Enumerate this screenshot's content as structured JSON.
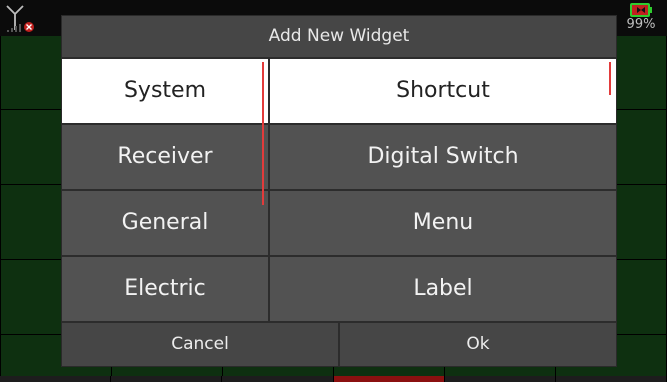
{
  "status": {
    "battery_percent": "99%"
  },
  "dialog": {
    "title": "Add New Widget",
    "categories": [
      "System",
      "Receiver",
      "General",
      "Electric"
    ],
    "widgets": [
      "Shortcut",
      "Digital Switch",
      "Menu",
      "Label"
    ],
    "selected_category": "System",
    "selected_widget": "Shortcut",
    "cancel_label": "Cancel",
    "ok_label": "Ok"
  },
  "colors": {
    "accent": "#e23b3b",
    "battery_red": "#c0201e",
    "battery_green": "#2ecc2e"
  }
}
